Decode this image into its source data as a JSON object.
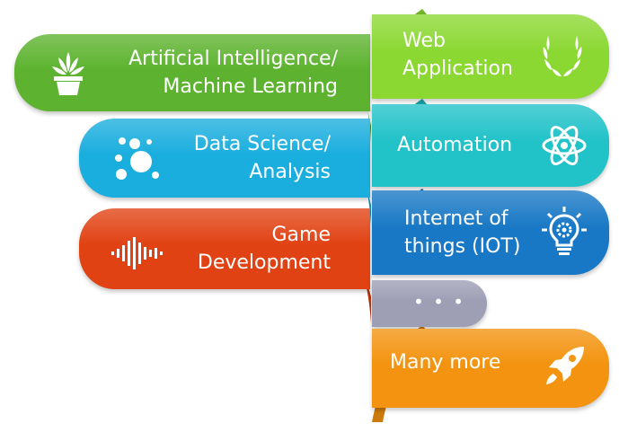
{
  "left_items": [
    {
      "id": "ai",
      "lines": [
        "Artificial Intelligence/",
        "Machine Learning"
      ],
      "icon": "plant-icon",
      "color": "#5db32f"
    },
    {
      "id": "ds",
      "lines": [
        "Data Science/",
        "Analysis"
      ],
      "icon": "bubbles-icon",
      "color": "#1aaede"
    },
    {
      "id": "game",
      "lines": [
        "Game",
        "Development"
      ],
      "icon": "sound-wave-icon",
      "color": "#e14213"
    }
  ],
  "right_items": [
    {
      "id": "web",
      "lines": [
        "Web",
        "Application"
      ],
      "icon": "laurel-icon",
      "color": "#8bd832"
    },
    {
      "id": "auto",
      "lines": [
        "Automation"
      ],
      "icon": "atom-icon",
      "color": "#22c2c9"
    },
    {
      "id": "iot",
      "lines": [
        "Internet of",
        "things (IOT)"
      ],
      "icon": "lightbulb-gear-icon",
      "color": "#1878c5"
    },
    {
      "id": "more_dots",
      "lines": [
        "• • •"
      ],
      "icon": "",
      "color": "#9e9fb5"
    },
    {
      "id": "many",
      "lines": [
        "Many more"
      ],
      "icon": "rocket-icon",
      "color": "#f3930f"
    }
  ]
}
